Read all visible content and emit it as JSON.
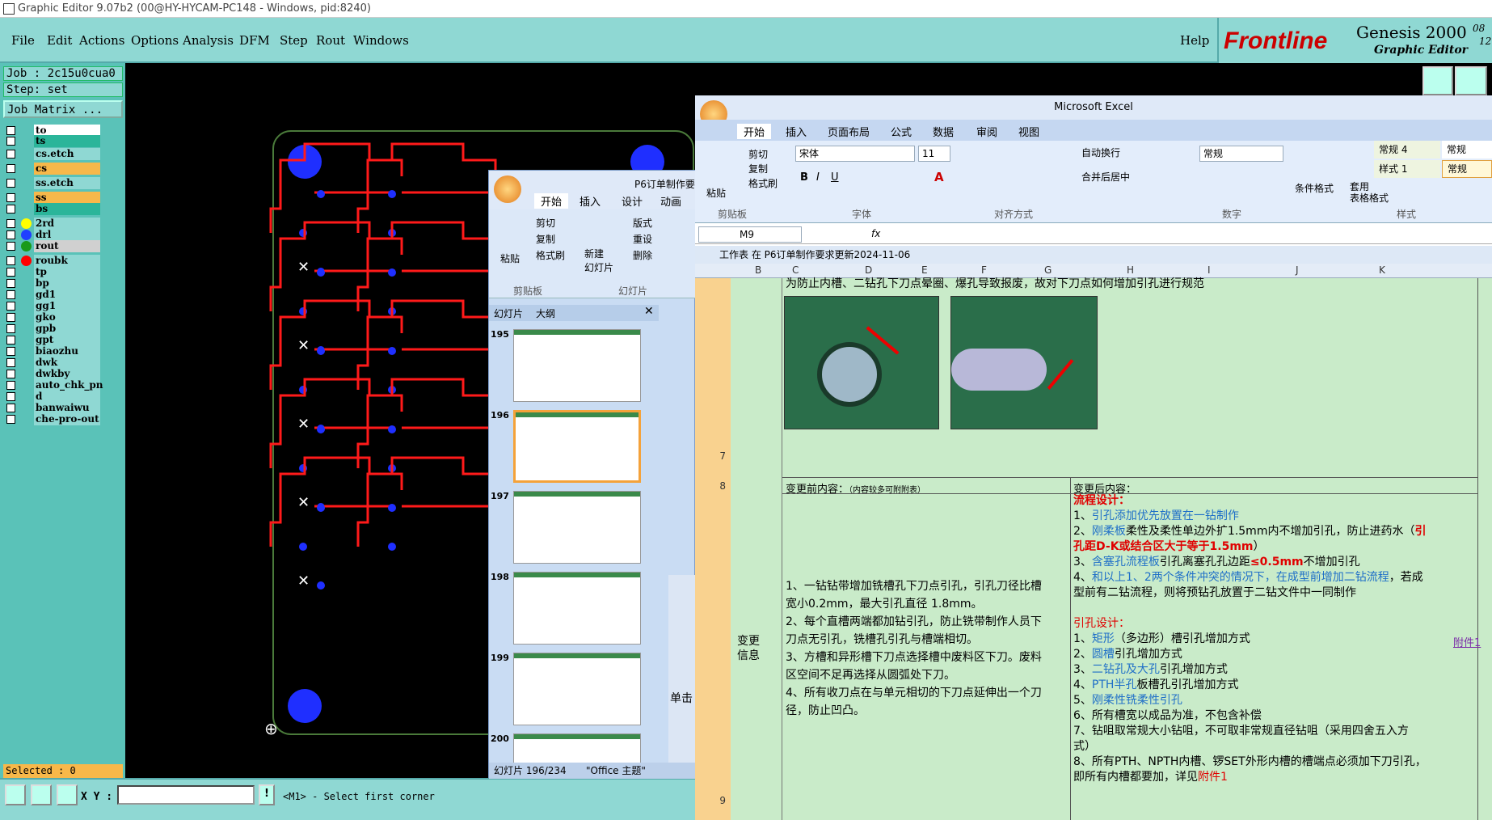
{
  "window_title": "Graphic Editor 9.07b2 (00@HY-HYCAM-PC148 - Windows, pid:8240)",
  "menu": [
    "File",
    "Edit",
    "Actions",
    "Options",
    "Analysis",
    "DFM",
    "Step",
    "Rout",
    "Windows"
  ],
  "help": "Help",
  "logo": {
    "brand": "Frontline",
    "product": "Genesis 2000",
    "sub": "Graphic Editor",
    "date1": "08",
    "date2": "12"
  },
  "job": "Job : 2c15u0cua0",
  "step": "Step: set",
  "job_matrix": "Job Matrix ...",
  "layers": [
    {
      "name": "to",
      "color": "#ffffff"
    },
    {
      "name": "ts",
      "color": "#2bb59a"
    },
    {
      "name": "cs.etch",
      "color": "#8fd8d3"
    },
    {
      "name": "cs",
      "color": "#f7b84a"
    },
    {
      "name": "ss.etch",
      "color": "#8fd8d3"
    },
    {
      "name": "ss",
      "color": "#f7b84a"
    },
    {
      "name": "bs",
      "color": "#2bb59a"
    },
    {
      "name": "2rd",
      "color": "#8fd8d3",
      "dot": "#ffff00"
    },
    {
      "name": "drl",
      "color": "#8fd8d3",
      "dot": "#1f3fff"
    },
    {
      "name": "rout",
      "color": "#d0d0d0",
      "dot": "#1a9a1a"
    },
    {
      "name": "roubk",
      "color": "#8fd8d3",
      "dot": "#ff0000"
    },
    {
      "name": "tp",
      "color": "#8fd8d3"
    },
    {
      "name": "bp",
      "color": "#8fd8d3"
    },
    {
      "name": "gd1",
      "color": "#8fd8d3"
    },
    {
      "name": "gg1",
      "color": "#8fd8d3"
    },
    {
      "name": "gko",
      "color": "#8fd8d3"
    },
    {
      "name": "gpb",
      "color": "#8fd8d3"
    },
    {
      "name": "gpt",
      "color": "#8fd8d3"
    },
    {
      "name": "biaozhu",
      "color": "#8fd8d3"
    },
    {
      "name": "dwk",
      "color": "#8fd8d3"
    },
    {
      "name": "dwkby",
      "color": "#8fd8d3"
    },
    {
      "name": "auto_chk_pn",
      "color": "#8fd8d3"
    },
    {
      "name": "d",
      "color": "#8fd8d3"
    },
    {
      "name": "banwaiwu",
      "color": "#8fd8d3"
    },
    {
      "name": "che-pro-out",
      "color": "#8fd8d3"
    }
  ],
  "selected": "Selected : 0",
  "xy_label": "X Y :",
  "status_msg": "<M1> - Select first corner",
  "ppt": {
    "title": "P6订单制作要",
    "tabs": [
      "开始",
      "插入",
      "设计",
      "动画"
    ],
    "clip_paste": "粘贴",
    "cut": "剪切",
    "copy": "复制",
    "format_painter": "格式刷",
    "clip_group": "剪贴板",
    "new_slide": "新建\n幻灯片",
    "layout": "版式",
    "reset": "重设",
    "delete": "删除",
    "slides_group": "幻灯片",
    "pane_tabs": [
      "幻灯片",
      "大纲"
    ],
    "slide_nums": [
      "195",
      "196",
      "197",
      "198",
      "199",
      "200"
    ],
    "status": "幻灯片 196/234",
    "theme": "\"Office 主题\"",
    "click": "单击"
  },
  "excel": {
    "title": "Microsoft Excel",
    "tabs": [
      "开始",
      "插入",
      "页面布局",
      "公式",
      "数据",
      "审阅",
      "视图"
    ],
    "font": "宋体",
    "size": "11",
    "number_format": "常规",
    "cut": "剪切",
    "copy": "复制",
    "painter": "格式刷",
    "paste": "粘贴",
    "wrap": "自动换行",
    "merge": "合并后居中",
    "cond_fmt": "条件格式",
    "table_fmt": "套用\n表格格式",
    "style1": "常规 4",
    "style2": "常规",
    "style3": "样式 1",
    "style4": "常规",
    "groups": [
      "剪贴板",
      "字体",
      "对齐方式",
      "数字",
      "样式"
    ],
    "namebox": "M9",
    "fx": "fx",
    "workbook": "工作表 在 P6订单制作要求更新2024-11-06",
    "cols": [
      "B",
      "C",
      "D",
      "E",
      "F",
      "G",
      "H",
      "I",
      "J",
      "K"
    ],
    "rows": [
      "7",
      "8",
      "9"
    ],
    "r7_text": "为防止内槽、二钻孔下刀点晕圈、爆孔导致报废，故对下刀点如何增加引孔进行规范",
    "r8_before": "变更前内容：",
    "r8_before_small": "（内容较多可附附表）",
    "r8_after": "变更后内容：",
    "side_label": "变更\n信息",
    "before_lines": [
      "1、一钻钻带增加铣槽孔下刀点引孔，引孔刀径比槽",
      "宽小0.2mm，最大引孔直径 1.8mm。",
      "2、每个直槽两端都加钻引孔，防止铣带制作人员下",
      "刀点无引孔，铣槽孔引孔与槽端相切。",
      "3、方槽和异形槽下刀点选择槽中废料区下刀。废料",
      "区空间不足再选择从圆弧处下刀。",
      "4、所有收刀点在与单元相切的下刀点延伸出一个刀",
      "径，防止凹凸。"
    ],
    "after": {
      "h1": "流程设计：",
      "l1a": "1、",
      "l1b": "引孔添加优先放置在一钻制作",
      "l2a": "2、",
      "l2b": "刚柔板",
      "l2c": "柔性及柔性单边外扩1.5mm内不增加引孔，防止进药水（",
      "l2d": "引",
      "l2e": "孔距D-K或结合区大于等于1.5mm",
      "l2f": "）",
      "l3a": "3、",
      "l3b": "含塞孔流程板",
      "l3c": "引孔离塞孔孔边距",
      "l3d": "≤0.5mm",
      "l3e": "不增加引孔",
      "l4a": "4、",
      "l4b": "和以上1、2两个条件冲突的情况下，在成型前增加二钻流程",
      "l4c": "，若成",
      "l4d": "型前有二钻流程，则将预钻孔放置于二钻文件中一同制作",
      "h2": "引孔设计：",
      "d1a": "1、",
      "d1b": "矩形",
      "d1c": "（多边形）槽引孔增加方式",
      "d2a": "2、",
      "d2b": "圆槽",
      "d2c": "引孔增加方式",
      "d3a": "3、",
      "d3b": "二钻孔及大孔",
      "d3c": "引孔增加方式",
      "d4a": "4、",
      "d4b": "PTH半孔",
      "d4c": "板槽孔引孔增加方式",
      "d5a": "5、",
      "d5b": "刚柔性铣柔性引孔",
      "d6": "6、所有槽宽以成品为准，不包含补偿",
      "d7": "7、钻咀取常规大小钻咀，不可取非常规直径钻咀（采用四舍五入方",
      "d7b": "式）",
      "d8": "8、所有PTH、NPTH内槽、锣SET外形内槽的槽端点必须加下刀引孔，",
      "d8b": "即所有内槽都要加，详见",
      "d8c": "附件1"
    },
    "attachment": "附件1"
  }
}
